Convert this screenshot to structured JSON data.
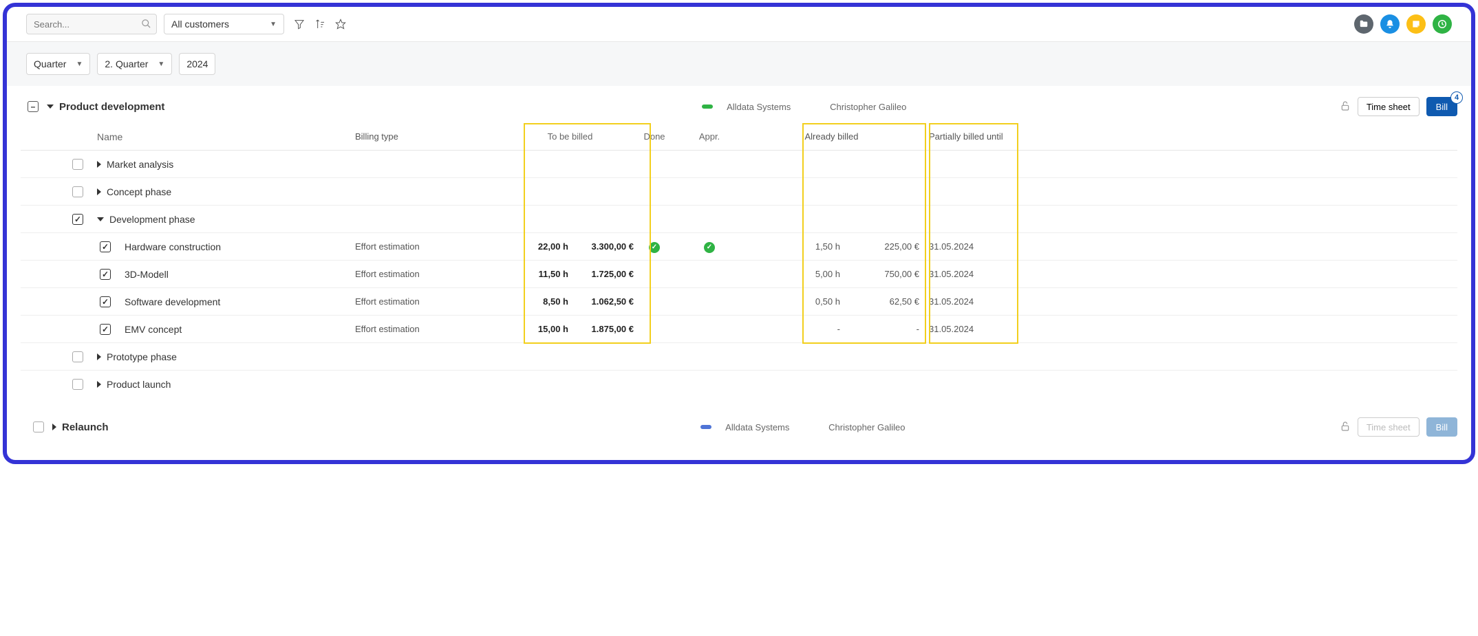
{
  "topbar": {
    "search_placeholder": "Search...",
    "customer_select": "All customers"
  },
  "subbar": {
    "period_type": "Quarter",
    "period_value": "2. Quarter",
    "year": "2024"
  },
  "project1": {
    "title": "Product development",
    "company": "Alldata Systems",
    "person": "Christopher Galileo",
    "timesheet_btn": "Time sheet",
    "bill_btn": "Bill",
    "bill_count": "4"
  },
  "columns": {
    "name": "Name",
    "billing_type": "Billing type",
    "to_be_billed": "To be billed",
    "done": "Done",
    "appr": "Appr.",
    "already_billed": "Already billed",
    "partially_billed_until": "Partially billed until"
  },
  "rows": {
    "market_analysis": {
      "name": "Market analysis"
    },
    "concept_phase": {
      "name": "Concept phase"
    },
    "development_phase": {
      "name": "Development phase"
    },
    "hardware": {
      "name": "Hardware construction",
      "billing_type": "Effort estimation",
      "tb_h": "22,00 h",
      "tb_eur": "3.300,00 €",
      "done": true,
      "appr": true,
      "ab_h": "1,50 h",
      "ab_eur": "225,00 €",
      "until": "31.05.2024"
    },
    "model3d": {
      "name": "3D-Modell",
      "billing_type": "Effort estimation",
      "tb_h": "11,50 h",
      "tb_eur": "1.725,00 €",
      "ab_h": "5,00 h",
      "ab_eur": "750,00 €",
      "until": "31.05.2024"
    },
    "software": {
      "name": "Software development",
      "billing_type": "Effort estimation",
      "tb_h": "8,50 h",
      "tb_eur": "1.062,50 €",
      "ab_h": "0,50 h",
      "ab_eur": "62,50 €",
      "until": "31.05.2024"
    },
    "emv": {
      "name": "EMV concept",
      "billing_type": "Effort estimation",
      "tb_h": "15,00 h",
      "tb_eur": "1.875,00 €",
      "ab_h": "-",
      "ab_eur": "-",
      "until": "31.05.2024"
    },
    "prototype": {
      "name": "Prototype phase"
    },
    "launch": {
      "name": "Product launch"
    }
  },
  "project2": {
    "title": "Relaunch",
    "company": "Alldata Systems",
    "person": "Christopher Galileo",
    "timesheet_btn": "Time sheet",
    "bill_btn": "Bill"
  }
}
